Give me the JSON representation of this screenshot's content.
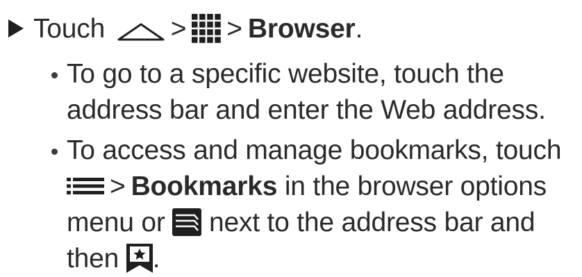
{
  "step": {
    "touch_label": "Touch",
    "sep_1": ">",
    "sep_2": ">",
    "browser_label": "Browser",
    "period": "."
  },
  "bullet_1": {
    "line_1": "To go to a specific website, touch the",
    "line_2": "address bar and enter the Web address."
  },
  "bullet_2": {
    "line_1": "To access and manage bookmarks, touch",
    "sep": ">",
    "bookmarks_label": "Bookmarks",
    "line_2_rest": " in the browser options",
    "line_3_start": "menu or ",
    "line_3_rest": " next to the address bar and",
    "line_4_start": "then ",
    "line_4_end": "."
  },
  "icons": {
    "home": "home-icon",
    "apps": "apps-grid-icon",
    "menu": "menu-icon",
    "tabs": "browser-tabs-icon",
    "bookmark": "bookmark-star-icon"
  },
  "colors": {
    "text": "#2a2a2a",
    "icon": "#1f1f1f"
  }
}
